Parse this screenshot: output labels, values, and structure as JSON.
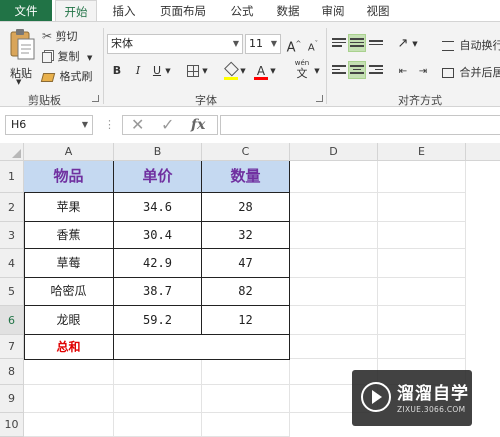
{
  "tabs": [
    {
      "label": "文件",
      "kind": "file"
    },
    {
      "label": "开始",
      "kind": "active"
    },
    {
      "label": "插入",
      "kind": "normal"
    },
    {
      "label": "页面布局",
      "kind": "normal"
    },
    {
      "label": "公式",
      "kind": "normal"
    },
    {
      "label": "数据",
      "kind": "normal"
    },
    {
      "label": "审阅",
      "kind": "normal"
    },
    {
      "label": "视图",
      "kind": "normal"
    }
  ],
  "ribbon": {
    "clipboard": {
      "paste": "粘贴",
      "cut": "剪切",
      "copy": "复制",
      "format_painter": "格式刷",
      "group_label": "剪贴板"
    },
    "font": {
      "font_name": "宋体",
      "font_size": "11",
      "grow": "A",
      "shrink": "A",
      "bold": "B",
      "italic": "I",
      "underline": "U",
      "font_color_glyph": "A",
      "phonetic": "wén",
      "phonetic_glyph": "文",
      "group_label": "字体"
    },
    "alignment": {
      "wrap_text": "自动换行",
      "merge_center": "合并后居",
      "group_label": "对齐方式"
    }
  },
  "formula_bar": {
    "name_box": "H6",
    "cancel_glyph": "✕",
    "enter_glyph": "✓",
    "fx_glyph": "fx",
    "formula": ""
  },
  "columns": [
    "A",
    "B",
    "C",
    "D",
    "E"
  ],
  "rows": [
    "1",
    "2",
    "3",
    "4",
    "5",
    "6",
    "7",
    "8",
    "9",
    "10"
  ],
  "table": {
    "headers": [
      "物品",
      "单价",
      "数量"
    ],
    "rows": [
      [
        "苹果",
        "34.6",
        "28"
      ],
      [
        "香蕉",
        "30.4",
        "32"
      ],
      [
        "草莓",
        "42.9",
        "47"
      ],
      [
        "哈密瓜",
        "38.7",
        "82"
      ],
      [
        "龙眼",
        "59.2",
        "12"
      ]
    ],
    "total_label": "总和"
  },
  "watermark": {
    "title": "溜溜自学",
    "url": "ZIXUE.3066.COM"
  },
  "colors": {
    "excel_green": "#217346",
    "header_fill": "#c5d9f1",
    "header_text": "#7030a0",
    "total_text": "#e00000"
  }
}
